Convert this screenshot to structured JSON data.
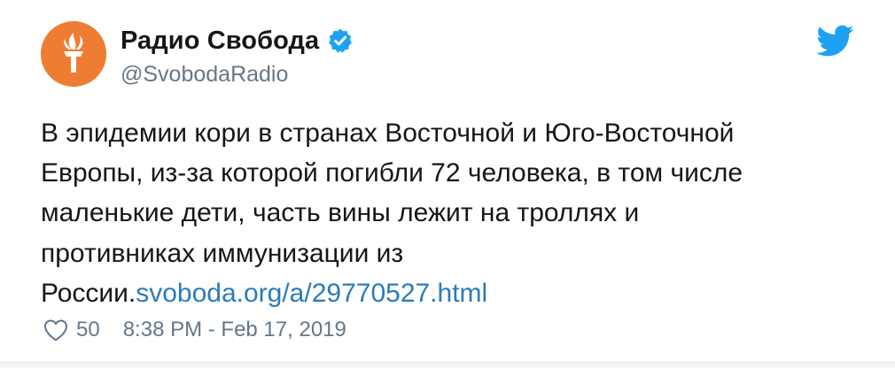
{
  "tweet": {
    "author": {
      "display_name": "Радио Свобода",
      "handle": "@SvobodaRadio",
      "verified": true,
      "avatar_icon": "rfe-rl-torch-logo",
      "avatar_color": "#ee7d33"
    },
    "text_lines": [
      "В эпидемии кори в странах Восточной и Юго-Восточной",
      "Европы, из-за которой погибли 72 человека, в том числе",
      "маленькие дети, часть вины лежит на троллях и",
      "противниках иммунизации из",
      "России."
    ],
    "link": "svoboda.org/a/29770527.html",
    "likes": "50",
    "timestamp": "8:38 PM - Feb 17, 2019",
    "colors": {
      "link": "#2b7bb9",
      "twitter_blue": "#1da1f2",
      "muted": "#657786"
    }
  }
}
